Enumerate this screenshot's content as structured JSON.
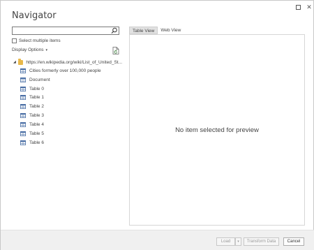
{
  "window": {
    "title": "Navigator",
    "restore_label": "",
    "close_label": "✕"
  },
  "search": {
    "value": "",
    "placeholder": ""
  },
  "select_multiple": {
    "label": "Select multiple items",
    "checked": false
  },
  "display_options": {
    "label": "Display Options",
    "caret": "▾"
  },
  "tree": {
    "root": {
      "label": "https://en.wikipedia.org/wiki/List_of_United_St...",
      "expander": "◢",
      "icon": "folder-icon"
    },
    "items": [
      {
        "label": "Cities formerly over 100,000 people",
        "icon": "table-icon"
      },
      {
        "label": "Document",
        "icon": "document-icon"
      },
      {
        "label": "Table 0",
        "icon": "table-icon"
      },
      {
        "label": "Table 1",
        "icon": "table-icon"
      },
      {
        "label": "Table 2",
        "icon": "table-icon"
      },
      {
        "label": "Table 3",
        "icon": "table-icon"
      },
      {
        "label": "Table 4",
        "icon": "table-icon"
      },
      {
        "label": "Table 5",
        "icon": "table-icon"
      },
      {
        "label": "Table 6",
        "icon": "table-icon"
      }
    ]
  },
  "tabs": [
    {
      "label": "Table View",
      "active": true
    },
    {
      "label": "Web View",
      "active": false
    }
  ],
  "preview": {
    "message": "No item selected for preview"
  },
  "footer": {
    "load_label": "Load",
    "load_arrow": "▾",
    "transform_label": "Transform Data",
    "cancel_label": "Cancel"
  },
  "colors": {
    "folder": "#e8b84a",
    "table_icon": "#4a6fa5",
    "footer_bg": "#f0f0f0",
    "active_tab_bg": "#e1e1e1"
  }
}
